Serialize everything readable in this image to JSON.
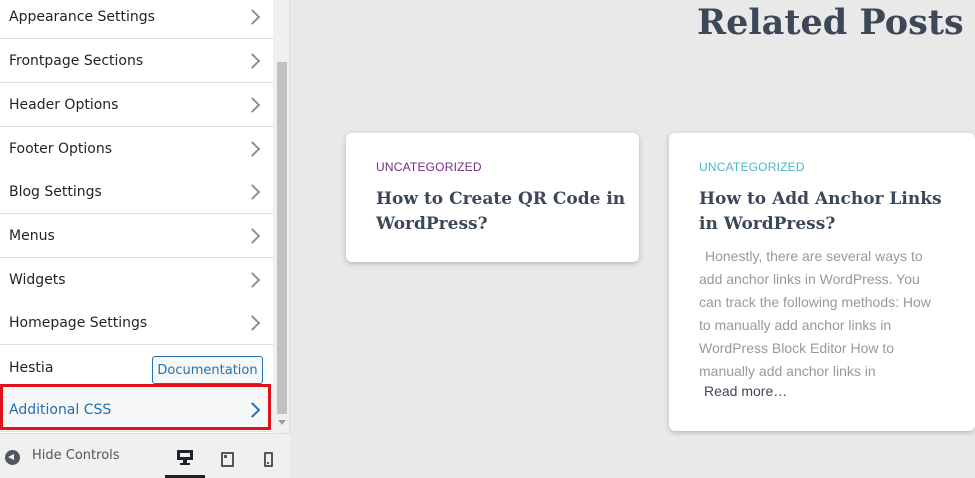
{
  "sidebar": {
    "items": [
      {
        "label": "Appearance Settings"
      },
      {
        "label": "Frontpage Sections"
      },
      {
        "label": "Header Options"
      },
      {
        "label": "Footer Options"
      },
      {
        "label": "Blog Settings"
      },
      {
        "label": "Menus"
      },
      {
        "label": "Widgets"
      },
      {
        "label": "Homepage Settings"
      }
    ],
    "hestia_label": "Hestia",
    "documentation_label": "Documentation",
    "additional_css_label": "Additional CSS"
  },
  "footer": {
    "hide_controls_label": "Hide Controls",
    "devices": [
      "desktop",
      "tablet",
      "mobile"
    ]
  },
  "preview": {
    "section_title": "Related Posts",
    "posts": [
      {
        "category": "UNCATEGORIZED",
        "title": "How to Create QR Code in WordPress?",
        "excerpt": "",
        "read_more": ""
      },
      {
        "category": "UNCATEGORIZED",
        "title": "How to Add Anchor Links in WordPress?",
        "excerpt": "Honestly, there are several ways to add anchor links in WordPress. You can track the following methods: How to manually add anchor links in WordPress Block Editor How to manually add anchor links in",
        "read_more": "Read more…"
      }
    ]
  },
  "colors": {
    "accent": "#2271b1",
    "highlight": "#e0121e",
    "category_1": "#7b2a86",
    "category_2": "#4fb6c3"
  }
}
